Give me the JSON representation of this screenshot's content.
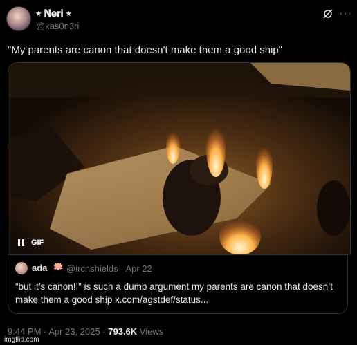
{
  "post": {
    "display_name": "⭒ 𝐍𝐞𝐫𝐢 ⭒",
    "handle": "@kas0n3ri",
    "text": "\"My parents are canon that doesn't make them a good ship\"",
    "media_badge": "GIF"
  },
  "quote": {
    "display_name": "ada",
    "emoji": "🪷",
    "handle_date": "@ircnshields · Apr 22",
    "text": "“but it’s canon!!” is such a dumb argument my parents are canon that doesn’t make them a good ship x.com/agstdef/status..."
  },
  "meta": {
    "timestamp": "9:44 PM · Apr 23, 2025 · ",
    "views_count": "793.6K",
    "views_label": " Views"
  },
  "watermark": "imgflip.com",
  "icons": {
    "grok": "grok-icon",
    "more": "more-icon",
    "pause": "pause-icon"
  }
}
